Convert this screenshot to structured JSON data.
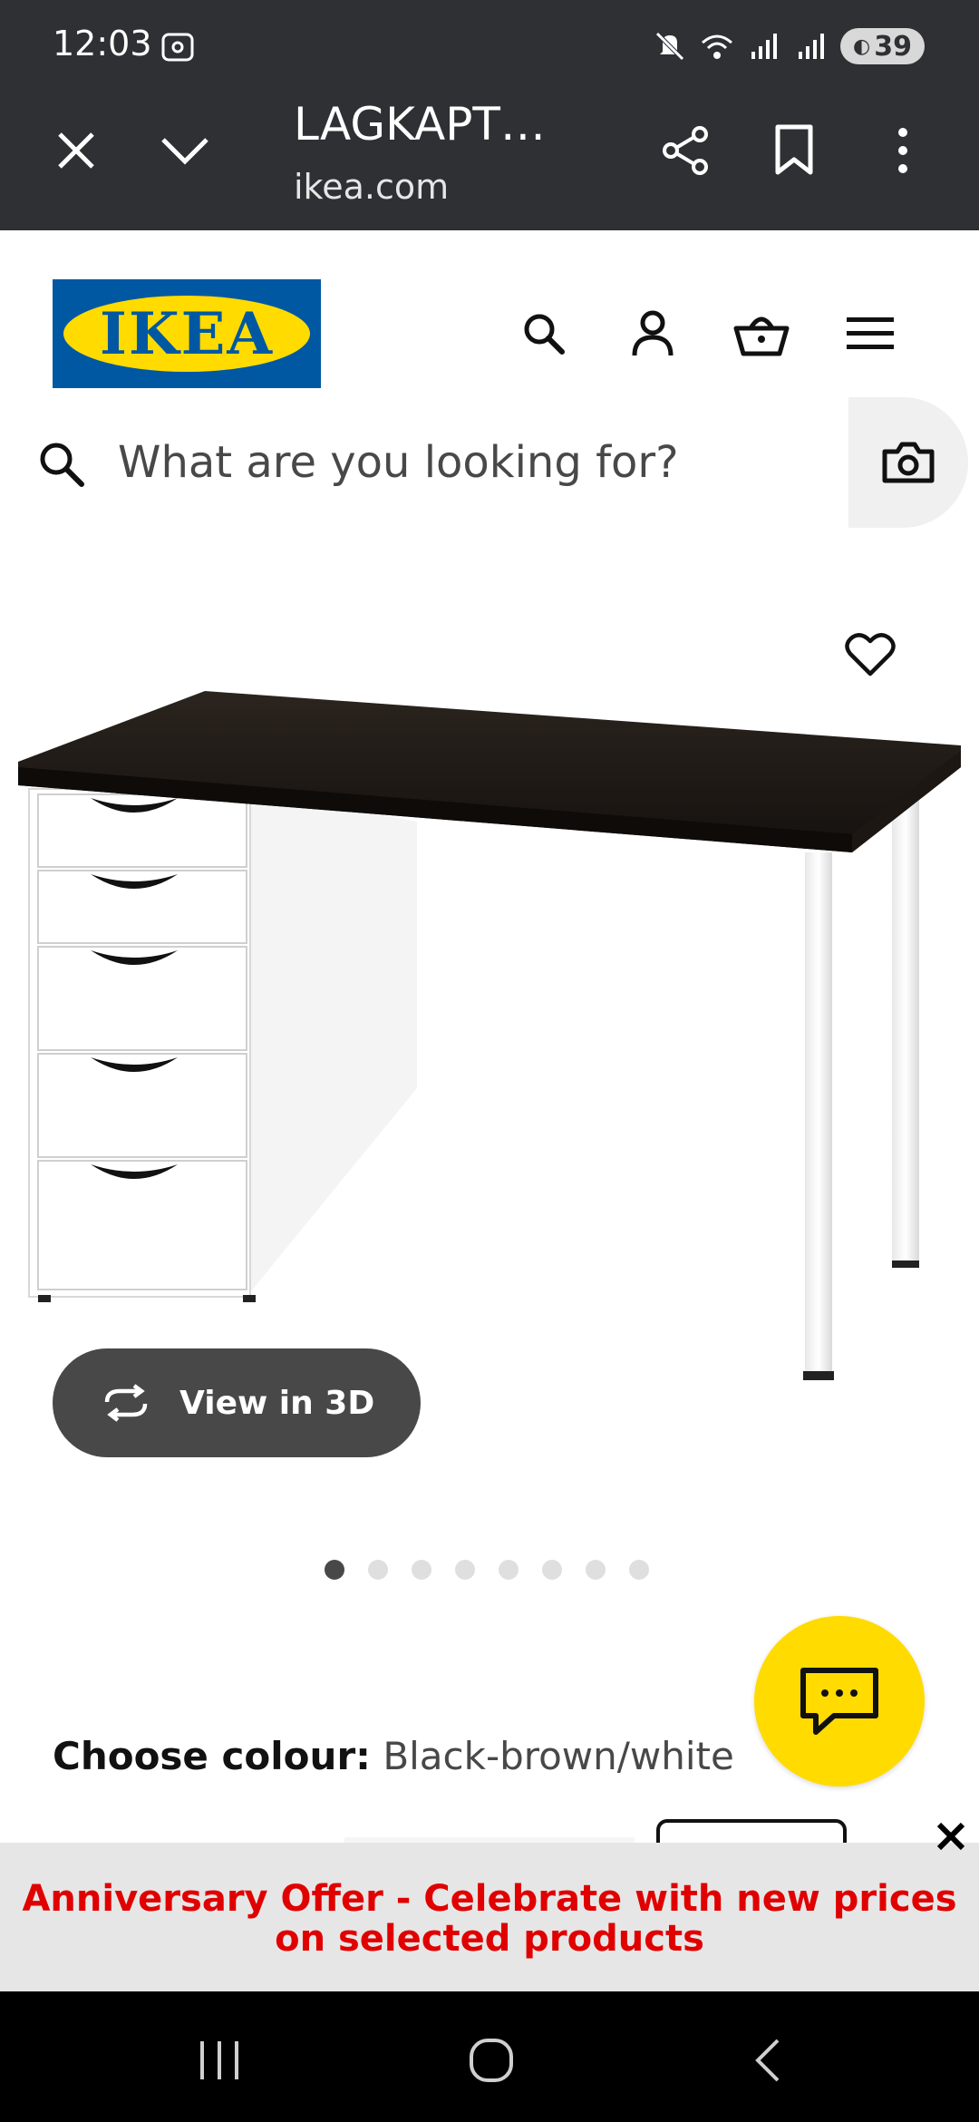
{
  "status_bar": {
    "time": "12:03",
    "battery": "39",
    "icons": [
      "screenshot-icon",
      "mute-icon",
      "wifi-icon",
      "signal-icon",
      "signal-icon",
      "battery-saver-icon"
    ]
  },
  "custom_tab": {
    "title": "LAGKAPT…",
    "url": "ikea.com",
    "icons": [
      "close-icon",
      "chevron-down-icon",
      "share-icon",
      "bookmark-icon",
      "more-vert-icon"
    ]
  },
  "header": {
    "logo_text": "IKEA",
    "icons": [
      "search-icon",
      "profile-icon",
      "basket-icon",
      "hamburger-menu-icon"
    ]
  },
  "search": {
    "placeholder": "What are you looking for?",
    "value": ""
  },
  "product": {
    "view_3d_label": "View in 3D",
    "carousel": {
      "total": 8,
      "active": 1
    }
  },
  "colour": {
    "label": "Choose colour:",
    "value": "Black-brown/white"
  },
  "offer_banner": {
    "text": "Anniversary Offer - Celebrate with new prices on selected products"
  },
  "colors": {
    "ikea_blue": "#0058a3",
    "ikea_yellow": "#ffdb00",
    "offer_red": "#e00000",
    "chrome_dark": "#2f3033"
  }
}
